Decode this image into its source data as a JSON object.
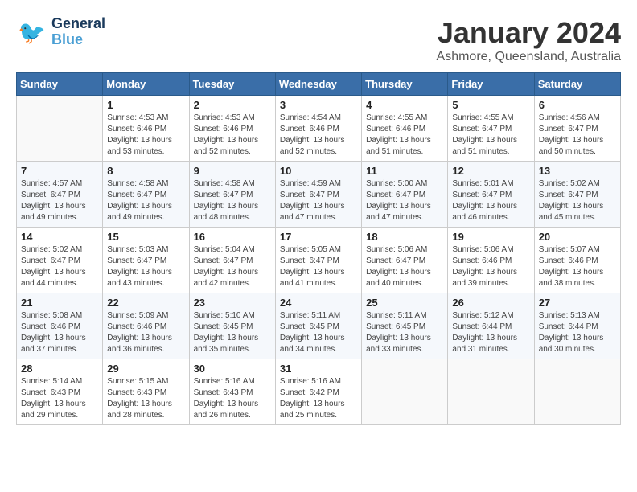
{
  "logo": {
    "line1": "General",
    "line2": "Blue"
  },
  "title": "January 2024",
  "location": "Ashmore, Queensland, Australia",
  "days_header": [
    "Sunday",
    "Monday",
    "Tuesday",
    "Wednesday",
    "Thursday",
    "Friday",
    "Saturday"
  ],
  "weeks": [
    [
      {
        "num": "",
        "info": ""
      },
      {
        "num": "1",
        "info": "Sunrise: 4:53 AM\nSunset: 6:46 PM\nDaylight: 13 hours\nand 53 minutes."
      },
      {
        "num": "2",
        "info": "Sunrise: 4:53 AM\nSunset: 6:46 PM\nDaylight: 13 hours\nand 52 minutes."
      },
      {
        "num": "3",
        "info": "Sunrise: 4:54 AM\nSunset: 6:46 PM\nDaylight: 13 hours\nand 52 minutes."
      },
      {
        "num": "4",
        "info": "Sunrise: 4:55 AM\nSunset: 6:46 PM\nDaylight: 13 hours\nand 51 minutes."
      },
      {
        "num": "5",
        "info": "Sunrise: 4:55 AM\nSunset: 6:47 PM\nDaylight: 13 hours\nand 51 minutes."
      },
      {
        "num": "6",
        "info": "Sunrise: 4:56 AM\nSunset: 6:47 PM\nDaylight: 13 hours\nand 50 minutes."
      }
    ],
    [
      {
        "num": "7",
        "info": "Sunrise: 4:57 AM\nSunset: 6:47 PM\nDaylight: 13 hours\nand 49 minutes."
      },
      {
        "num": "8",
        "info": "Sunrise: 4:58 AM\nSunset: 6:47 PM\nDaylight: 13 hours\nand 49 minutes."
      },
      {
        "num": "9",
        "info": "Sunrise: 4:58 AM\nSunset: 6:47 PM\nDaylight: 13 hours\nand 48 minutes."
      },
      {
        "num": "10",
        "info": "Sunrise: 4:59 AM\nSunset: 6:47 PM\nDaylight: 13 hours\nand 47 minutes."
      },
      {
        "num": "11",
        "info": "Sunrise: 5:00 AM\nSunset: 6:47 PM\nDaylight: 13 hours\nand 47 minutes."
      },
      {
        "num": "12",
        "info": "Sunrise: 5:01 AM\nSunset: 6:47 PM\nDaylight: 13 hours\nand 46 minutes."
      },
      {
        "num": "13",
        "info": "Sunrise: 5:02 AM\nSunset: 6:47 PM\nDaylight: 13 hours\nand 45 minutes."
      }
    ],
    [
      {
        "num": "14",
        "info": "Sunrise: 5:02 AM\nSunset: 6:47 PM\nDaylight: 13 hours\nand 44 minutes."
      },
      {
        "num": "15",
        "info": "Sunrise: 5:03 AM\nSunset: 6:47 PM\nDaylight: 13 hours\nand 43 minutes."
      },
      {
        "num": "16",
        "info": "Sunrise: 5:04 AM\nSunset: 6:47 PM\nDaylight: 13 hours\nand 42 minutes."
      },
      {
        "num": "17",
        "info": "Sunrise: 5:05 AM\nSunset: 6:47 PM\nDaylight: 13 hours\nand 41 minutes."
      },
      {
        "num": "18",
        "info": "Sunrise: 5:06 AM\nSunset: 6:47 PM\nDaylight: 13 hours\nand 40 minutes."
      },
      {
        "num": "19",
        "info": "Sunrise: 5:06 AM\nSunset: 6:46 PM\nDaylight: 13 hours\nand 39 minutes."
      },
      {
        "num": "20",
        "info": "Sunrise: 5:07 AM\nSunset: 6:46 PM\nDaylight: 13 hours\nand 38 minutes."
      }
    ],
    [
      {
        "num": "21",
        "info": "Sunrise: 5:08 AM\nSunset: 6:46 PM\nDaylight: 13 hours\nand 37 minutes."
      },
      {
        "num": "22",
        "info": "Sunrise: 5:09 AM\nSunset: 6:46 PM\nDaylight: 13 hours\nand 36 minutes."
      },
      {
        "num": "23",
        "info": "Sunrise: 5:10 AM\nSunset: 6:45 PM\nDaylight: 13 hours\nand 35 minutes."
      },
      {
        "num": "24",
        "info": "Sunrise: 5:11 AM\nSunset: 6:45 PM\nDaylight: 13 hours\nand 34 minutes."
      },
      {
        "num": "25",
        "info": "Sunrise: 5:11 AM\nSunset: 6:45 PM\nDaylight: 13 hours\nand 33 minutes."
      },
      {
        "num": "26",
        "info": "Sunrise: 5:12 AM\nSunset: 6:44 PM\nDaylight: 13 hours\nand 31 minutes."
      },
      {
        "num": "27",
        "info": "Sunrise: 5:13 AM\nSunset: 6:44 PM\nDaylight: 13 hours\nand 30 minutes."
      }
    ],
    [
      {
        "num": "28",
        "info": "Sunrise: 5:14 AM\nSunset: 6:43 PM\nDaylight: 13 hours\nand 29 minutes."
      },
      {
        "num": "29",
        "info": "Sunrise: 5:15 AM\nSunset: 6:43 PM\nDaylight: 13 hours\nand 28 minutes."
      },
      {
        "num": "30",
        "info": "Sunrise: 5:16 AM\nSunset: 6:43 PM\nDaylight: 13 hours\nand 26 minutes."
      },
      {
        "num": "31",
        "info": "Sunrise: 5:16 AM\nSunset: 6:42 PM\nDaylight: 13 hours\nand 25 minutes."
      },
      {
        "num": "",
        "info": ""
      },
      {
        "num": "",
        "info": ""
      },
      {
        "num": "",
        "info": ""
      }
    ]
  ]
}
